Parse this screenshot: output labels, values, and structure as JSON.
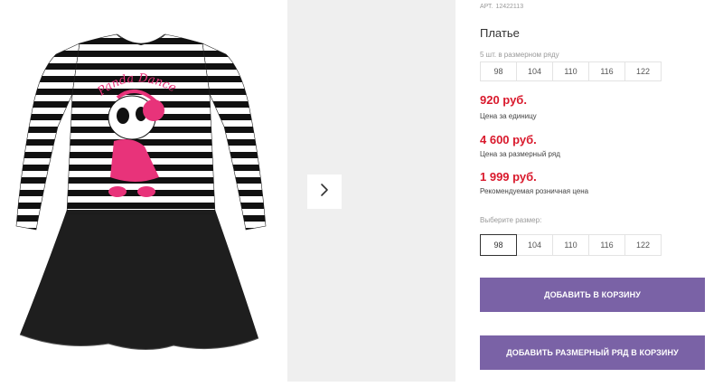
{
  "product": {
    "sku_label": "АРТ.",
    "sku_value": "12422113",
    "title": "Платье",
    "pack_note": "5 шт. в размерном ряду",
    "pack_sizes": [
      "98",
      "104",
      "110",
      "116",
      "122"
    ],
    "prices": {
      "unit": "920 руб.",
      "unit_caption": "Цена за единицу",
      "pack": "4 600 руб.",
      "pack_caption": "Цена за размерный ряд",
      "retail": "1 999 руб.",
      "retail_caption": "Рекомендуемая розничная цена"
    },
    "choose_size_label": "Выберите размер:",
    "select_sizes": [
      "98",
      "104",
      "110",
      "116",
      "122"
    ],
    "selected_size": "98",
    "image_print_text": "Panda Dance"
  },
  "actions": {
    "add_to_cart": "ДОБАВИТЬ В КОРЗИНУ",
    "add_pack_to_cart": "ДОБАВИТЬ РАЗМЕРНЫЙ РЯД В КОРЗИНУ"
  },
  "icons": {
    "gallery_next": "chevron-right-icon"
  },
  "colors": {
    "price": "#d9192c",
    "button": "#7a62a6",
    "panel": "#efefef"
  }
}
